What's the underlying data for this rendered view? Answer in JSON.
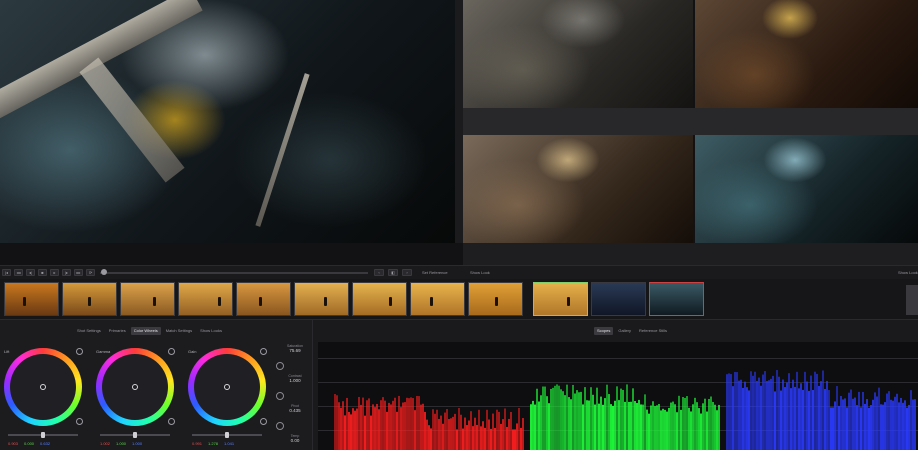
{
  "transport": {
    "reference_label": "Set Reference",
    "still_left_label": "Show Look",
    "still_right_label": "Show Look"
  },
  "thumbnails": [
    {
      "label": "",
      "tone": "#c9781e",
      "tone2": "#6a3a12"
    },
    {
      "label": "",
      "tone": "#d59a3a",
      "tone2": "#7a4a1a"
    },
    {
      "label": "",
      "tone": "#dca24a",
      "tone2": "#8a5a22"
    },
    {
      "label": "",
      "tone": "#e0a848",
      "tone2": "#946024"
    },
    {
      "label": "",
      "tone": "#d89840",
      "tone2": "#8a5620"
    },
    {
      "label": "",
      "tone": "#e4b050",
      "tone2": "#a06a26"
    },
    {
      "label": "",
      "tone": "#e6b44e",
      "tone2": "#a46c24"
    },
    {
      "label": "",
      "tone": "#e8b44c",
      "tone2": "#b07428"
    },
    {
      "label": "",
      "tone": "#e0a036",
      "tone2": "#a86a1c"
    },
    {
      "label": "",
      "tone": "#e6b04a",
      "tone2": "#b0762a"
    },
    {
      "label": "",
      "tone": "#2a3a55",
      "tone2": "#101626"
    },
    {
      "label": "",
      "tone": "#3a5a66",
      "tone2": "#101a20"
    }
  ],
  "tabs_left": [
    "Shot Settings",
    "Primaries",
    "Color Wheels",
    "Match Settings",
    "Show Looks"
  ],
  "tabs_right": [
    "Scopes",
    "Gallery",
    "Reference Stills"
  ],
  "wheels": [
    {
      "name": "Lift",
      "values": {
        "r": "0.903",
        "g": "0.000",
        "b": "0.632"
      }
    },
    {
      "name": "Gamma",
      "values": {
        "r": "1.002",
        "g": "1.000",
        "b": "1.000"
      }
    },
    {
      "name": "Gain",
      "values": {
        "r": "0.991",
        "g": "1.278",
        "b": "1.041"
      }
    }
  ],
  "params": [
    {
      "name": "Saturation",
      "value": "75.69"
    },
    {
      "name": "Contrast",
      "value": "1.000"
    },
    {
      "name": "Pivot",
      "value": "0.435"
    },
    {
      "name": "Temp",
      "value": "0.00"
    }
  ],
  "colors": {
    "accent_green": "#7fd06a",
    "accent_red": "#d04040",
    "scope_red": "#ff1e1e",
    "scope_green": "#1eff3a",
    "scope_blue": "#2a3aff"
  }
}
